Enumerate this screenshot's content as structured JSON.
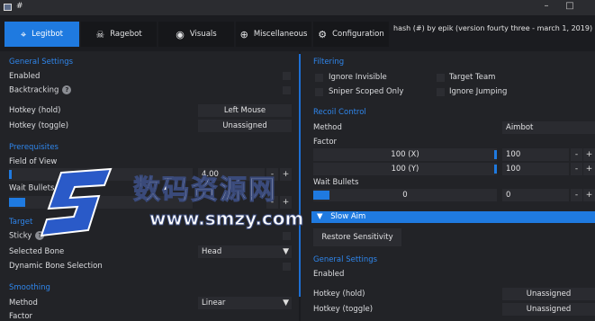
{
  "window": {
    "title": "#",
    "icon": "app-window-icon",
    "controls": [
      "–",
      "□"
    ]
  },
  "tabs": [
    {
      "label": "Legitbot",
      "icon": "crosshair-icon",
      "active": true
    },
    {
      "label": "Ragebot",
      "icon": "skull-icon",
      "active": false
    },
    {
      "label": "Visuals",
      "icon": "eye-icon",
      "active": false
    },
    {
      "label": "Miscellaneous",
      "icon": "plus-circle-icon",
      "active": false
    },
    {
      "label": "Configuration",
      "icon": "gear-icon",
      "active": false
    }
  ],
  "version": "hash (#) by epik (version fourty three - march 1, 2019)",
  "left": {
    "general": {
      "title": "General Settings",
      "enabled": "Enabled",
      "backtracking": "Backtracking",
      "hotkey_hold": "Hotkey (hold)",
      "hotkey_hold_value": "Left Mouse",
      "hotkey_toggle": "Hotkey (toggle)",
      "hotkey_toggle_value": "Unassigned"
    },
    "prereq": {
      "title": "Prerequisites",
      "fov_label": "Field of View",
      "fov_slider": "4.00",
      "fov_value": "4.00",
      "wait_bullets": "Wait Bullets"
    },
    "target": {
      "title": "Target",
      "sticky": "Sticky",
      "selected_bone": "Selected Bone",
      "selected_bone_value": "Head",
      "dynamic_bone": "Dynamic Bone Selection"
    },
    "smoothing": {
      "title": "Smoothing",
      "method": "Method",
      "method_value": "Linear",
      "factor": "Factor"
    }
  },
  "right": {
    "filtering": {
      "title": "Filtering",
      "ignore_invisible": "Ignore Invisible",
      "target_team": "Target Team",
      "sniper_scoped": "Sniper Scoped Only",
      "ignore_jumping": "Ignore Jumping"
    },
    "recoil": {
      "title": "Recoil Control",
      "method": "Method",
      "method_value": "Aimbot",
      "factor": "Factor",
      "x_slider": "100 (X)",
      "x_value": "100",
      "y_slider": "100 (Y)",
      "y_value": "100",
      "wait_bullets": "Wait Bullets",
      "wait_slider": "0",
      "wait_value": "0"
    },
    "slow_aim": "Slow Aim",
    "restore": "Restore Sensitivity",
    "general": {
      "title": "General Settings",
      "enabled": "Enabled",
      "hotkey_hold": "Hotkey (hold)",
      "hotkey_hold_value": "Unassigned",
      "hotkey_toggle": "Hotkey (toggle)",
      "hotkey_toggle_value": "Unassigned"
    }
  },
  "controls": {
    "minus": "-",
    "plus": "+",
    "help": "?",
    "dropdown": "▼",
    "collapse": "▼"
  },
  "watermark": {
    "brand": "数码资源网",
    "url": "www.smzy.com"
  },
  "colors": {
    "accent": "#1f7ae0",
    "section": "#2f86ec",
    "background": "#1b1c20",
    "panel": "#222327"
  }
}
